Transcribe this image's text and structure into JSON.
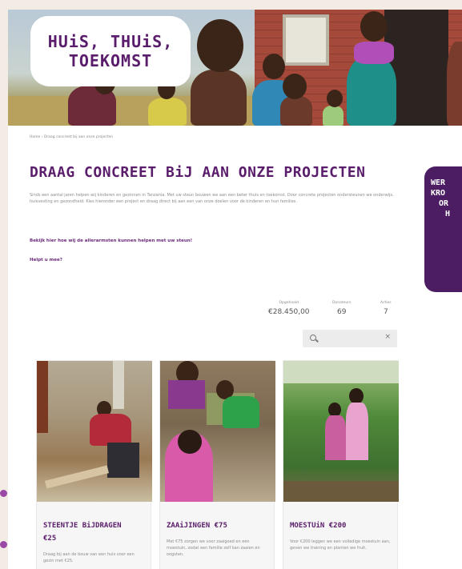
{
  "hero": {
    "title_lines": [
      "HUiS, THUiS,",
      "TOEKOMST"
    ]
  },
  "breadcrumb": "Home › Draag concreet bij aan onze projecten",
  "page_title": "DRAAG CONCREET BiJ AAN ONZE PROJECTEN",
  "intro": "Sinds een aantal jaren helpen wij kinderen en gezinnen in Tanzania. Met uw steun bouwen we aan een beter thuis en toekomst. Door concrete projecten ondersteunen we onderwijs, huisvesting en gezondheid. Kies hieronder een project en draag direct bij aan een van onze doelen voor de kinderen en hun families.",
  "links": {
    "help_info": "Bekijk hier hoe wij de allerarmsten kunnen helpen met uw steun!",
    "help_more": "Helpt u mee?"
  },
  "side_banner": [
    "WER",
    "",
    "KRO",
    "OR",
    "H"
  ],
  "stats": [
    {
      "label": "Opgehaald",
      "value": "€28.450,00"
    },
    {
      "label": "Donateurs",
      "value": "69"
    },
    {
      "label": "Acties",
      "value": "7"
    }
  ],
  "search": {
    "placeholder": "",
    "clear": "×"
  },
  "cards": [
    {
      "title_lines": [
        "STEENTJE BiJDRAGEN",
        "€25"
      ],
      "desc": "Draag bij aan de bouw van een huis voor een gezin met €25."
    },
    {
      "title_lines": [
        "ZAAiJINGEN €75"
      ],
      "desc": "Met €75 zorgen we voor zaaigoed en een moestuin, zodat een familie zelf kan zaaien en oogsten."
    },
    {
      "title_lines": [
        "MOESTUiN €200"
      ],
      "desc": "Voor €200 leggen we een volledige moestuin aan, geven we training en planten we fruit."
    }
  ]
}
